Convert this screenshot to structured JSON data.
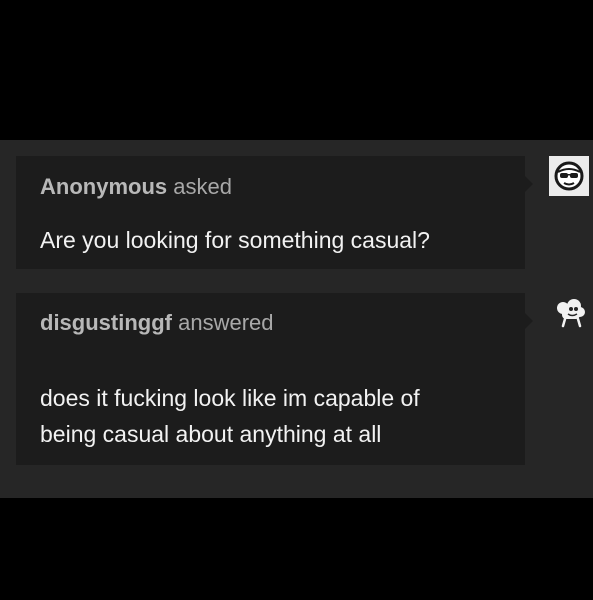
{
  "ask": {
    "asker_name": "Anonymous",
    "asker_verb": "asked",
    "question": "Are you looking for something casual?",
    "avatar_icon": "anonymous-sunglasses-icon"
  },
  "answer": {
    "answerer_name": "disgustinggf",
    "answerer_verb": "answered",
    "lines": [
      "does it fucking look like im capable of",
      "being casual about anything at all"
    ],
    "avatar_icon": "user-avatar-icon"
  },
  "colors": {
    "background": "#000000",
    "panel": "#262626",
    "bubble": "#1c1c1c",
    "text": "#f2f2f2",
    "muted": "#a8a8a8"
  }
}
